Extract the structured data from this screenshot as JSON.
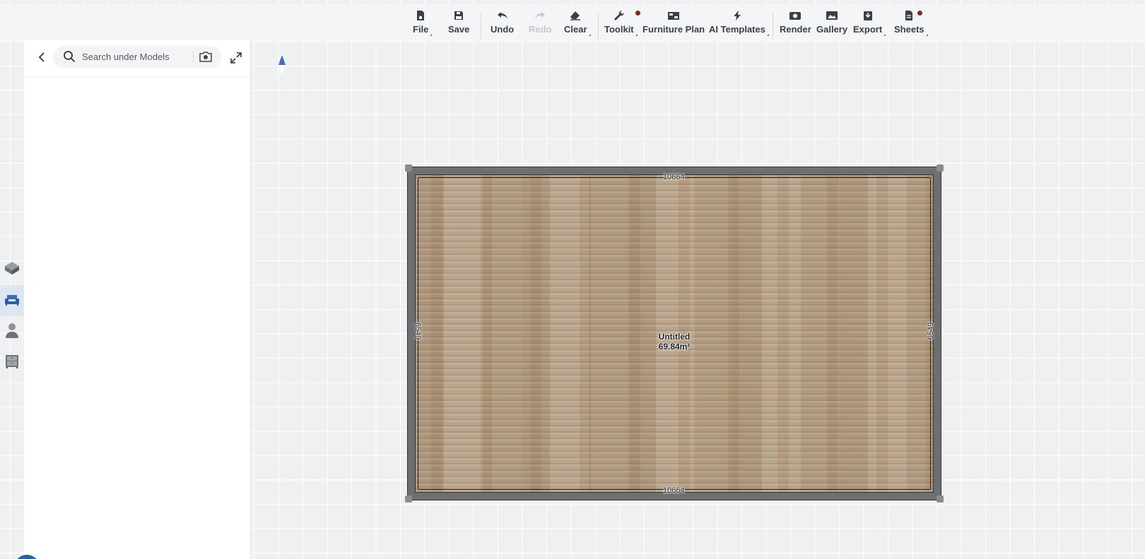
{
  "toolbar": {
    "file": "File",
    "save": "Save",
    "undo": "Undo",
    "redo": "Redo",
    "clear": "Clear",
    "toolkit": "Toolkit",
    "furniture_plan": "Furniture Plan",
    "ai_templates": "AI Templates",
    "render": "Render",
    "gallery": "Gallery",
    "export": "Export",
    "sheets": "Sheets"
  },
  "panel": {
    "search_placeholder": "Search under Models"
  },
  "rail": {
    "items": [
      "cube-icon",
      "sofa-icon",
      "person-icon",
      "cabinet-icon"
    ],
    "active": "sofa-icon"
  },
  "plan": {
    "room_name": "Untitled",
    "room_area": "69.84m²",
    "dim_top": "10664",
    "dim_bottom": "10664",
    "dim_left": "6549",
    "dim_right": "6549"
  },
  "colors": {
    "accent": "#2f5f9a",
    "notify_dot": "#7a2a1e",
    "wall": "#6e6f71"
  }
}
